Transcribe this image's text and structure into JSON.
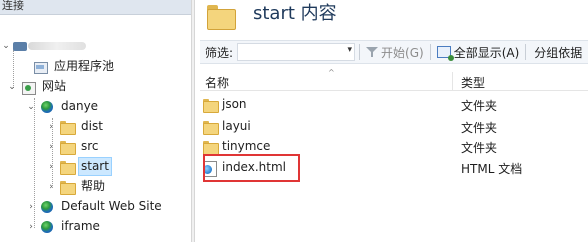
{
  "left_pane": {
    "header": "连接",
    "server_name": "",
    "tree": [
      {
        "label": "应用程序池",
        "icon": "app-pool-icon",
        "expanded": false,
        "selected": false
      },
      {
        "label": "网站",
        "icon": "sites-icon",
        "expanded": true,
        "selected": false
      },
      {
        "label": "danye",
        "icon": "globe-icon",
        "expanded": true,
        "selected": false
      },
      {
        "label": "dist",
        "icon": "folder-icon",
        "expanded": false,
        "selected": false
      },
      {
        "label": "src",
        "icon": "folder-icon",
        "expanded": false,
        "selected": false
      },
      {
        "label": "start",
        "icon": "folder-icon",
        "expanded": false,
        "selected": true
      },
      {
        "label": "帮助",
        "icon": "folder-icon",
        "expanded": false,
        "selected": false
      },
      {
        "label": "Default Web Site",
        "icon": "globe-icon",
        "expanded": false,
        "selected": false
      },
      {
        "label": "iframe",
        "icon": "globe-icon",
        "expanded": false,
        "selected": false
      }
    ]
  },
  "content": {
    "title": "start 内容",
    "toolbar": {
      "filter_label": "筛选:",
      "filter_value": "",
      "go_label": "开始(G)",
      "show_all_label": "全部显示(A)",
      "group_label": "分组依据"
    },
    "columns": {
      "name": "名称",
      "type": "类型"
    },
    "files": [
      {
        "name": "json",
        "type": "文件夹",
        "icon": "folder-icon"
      },
      {
        "name": "layui",
        "type": "文件夹",
        "icon": "folder-icon"
      },
      {
        "name": "tinymce",
        "type": "文件夹",
        "icon": "folder-icon"
      },
      {
        "name": "index.html",
        "type": "HTML 文档",
        "icon": "html-file-icon",
        "highlighted": true
      }
    ],
    "highlight_color": "#e03535"
  },
  "colors": {
    "selection_bg": "#cce8ff",
    "title_text": "#1e395b",
    "folder": "#f4d57d"
  }
}
